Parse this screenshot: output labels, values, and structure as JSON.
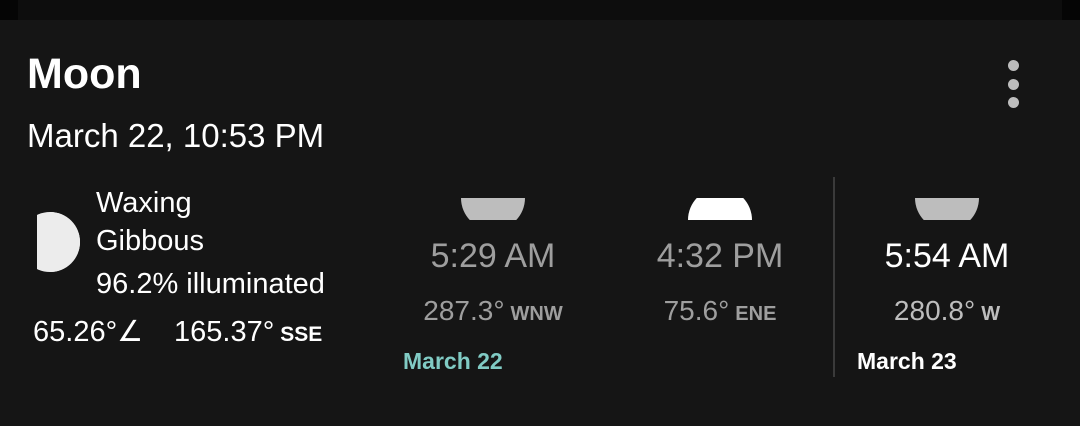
{
  "card": {
    "title": "Moon",
    "datetime": "March 22, 10:53 PM"
  },
  "phase": {
    "name_line1": "Waxing",
    "name_line2": "Gibbous",
    "illumination": "96.2% illuminated",
    "altitude": "65.26°∠",
    "azimuth": "165.37°",
    "azimuth_dir": "SSE"
  },
  "events": [
    {
      "time": "5:29 AM",
      "azimuth": "287.3°",
      "direction": "WNW",
      "type": "set"
    },
    {
      "time": "4:32 PM",
      "azimuth": "75.6°",
      "direction": "ENE",
      "type": "rise"
    },
    {
      "time": "5:54 AM",
      "azimuth": "280.8°",
      "direction": "W",
      "type": "set"
    }
  ],
  "dates": {
    "today": "March 22",
    "tomorrow": "March 23"
  },
  "colors": {
    "background": "#151515",
    "accent_today": "#80cbc4",
    "muted_text": "#9e9e9e",
    "arc_set": "#bdbdbd",
    "arc_rise": "#ffffff"
  },
  "icons": {
    "menu": "more-vert-icon",
    "moon": "moon-phase-icon",
    "set": "moonset-arc-icon",
    "rise": "moonrise-arc-icon"
  }
}
